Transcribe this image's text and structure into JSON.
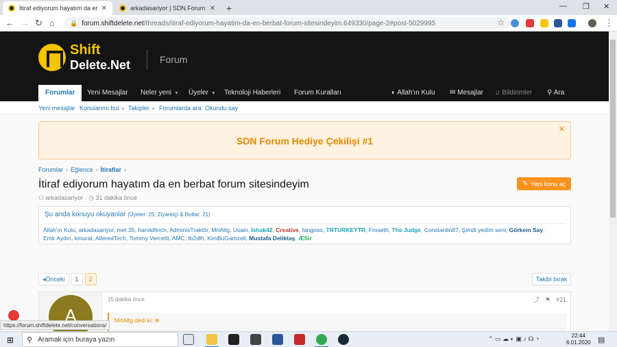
{
  "browser": {
    "tabs": [
      {
        "title": "İtiraf ediyorum hayatım da en be"
      },
      {
        "title": "arkadasariyor | SDN Forum"
      }
    ],
    "new_tab": "+",
    "url_host": "forum.shiftdelete.net",
    "url_path": "/threads/itiraf-ediyorum-hayatim-da-en-berbat-forum-sitesindeyim.649330/page-2#post-5029995"
  },
  "site": {
    "logo_line1": "Shift",
    "logo_line2": "Delete.Net",
    "section": "Forum"
  },
  "nav": {
    "items": [
      "Forumlar",
      "Yeni Mesajlar",
      "Neler yeni",
      "Üyeler",
      "Teknoloji Haberleri",
      "Forum Kuralları"
    ],
    "user": "Allah'ın Kulu",
    "messages": "Mesajlar",
    "alerts": "Bildirimler",
    "search": "Ara"
  },
  "subnav": [
    "Yeni mesajlar",
    "Konulanmı bul",
    "Takipler",
    "Forumlarda ara",
    "Okundu say"
  ],
  "notice": "SDN Forum Hediye Çekilişi #1",
  "breadcrumb": [
    "Forumlar",
    "Eğlence",
    "İtiraflar"
  ],
  "thread": {
    "title": "İtiraf ediyorum hayatım da en berbat forum sitesindeyim",
    "author": "arkadasariyor",
    "time": "31 dakika önce",
    "new_thread_label": "Yeni konu aç"
  },
  "viewers": {
    "heading": "Şu anda konuyu okuyanlar",
    "subheading": "(Üyeler: 25, Ziyaretçi & Botlar: 21)",
    "names": [
      {
        "name": "Allah'ın Kulu",
        "color": "#2577b1",
        "bold": false
      },
      {
        "name": "arkadasariyor",
        "color": "#2577b1",
        "bold": false
      },
      {
        "name": "met 35",
        "color": "#2577b1",
        "bold": false
      },
      {
        "name": "haroldfinch",
        "color": "#2577b1",
        "bold": false
      },
      {
        "name": "AdminisTraktör",
        "color": "#2577b1",
        "bold": false
      },
      {
        "name": "MrtAltg",
        "color": "#2577b1",
        "bold": false
      },
      {
        "name": "Usain",
        "color": "#2577b1",
        "bold": false
      },
      {
        "name": "İshak42",
        "color": "#17a2b8",
        "bold": true
      },
      {
        "name": "Creative",
        "color": "#c0392b",
        "bold": true
      },
      {
        "name": "fangoso",
        "color": "#2577b1",
        "bold": false
      },
      {
        "name": "TRTURKEYTR",
        "color": "#17a2b8",
        "bold": true
      },
      {
        "name": "Froseth",
        "color": "#2577b1",
        "bold": false
      },
      {
        "name": "The Judge",
        "color": "#17a2b8",
        "bold": true
      },
      {
        "name": "Constantin87",
        "color": "#2577b1",
        "bold": false
      },
      {
        "name": "Şimdi yedim seni",
        "color": "#2577b1",
        "bold": false
      },
      {
        "name": "Görkem Say",
        "color": "#1c5a8c",
        "bold": true
      },
      {
        "name": "Emir Aydın",
        "color": "#2577b1",
        "bold": false
      },
      {
        "name": "kmurat",
        "color": "#2577b1",
        "bold": false
      },
      {
        "name": "AlteredTech",
        "color": "#2577b1",
        "bold": false
      },
      {
        "name": "Tommy Vercetti",
        "color": "#2577b1",
        "bold": false
      },
      {
        "name": "AMC",
        "color": "#2577b1",
        "bold": false
      },
      {
        "name": "tb2dlh",
        "color": "#2577b1",
        "bold": false
      },
      {
        "name": "KimBuGamzeli",
        "color": "#2577b1",
        "bold": false
      },
      {
        "name": "Mustafa Deliktaş",
        "color": "#1c5a8c",
        "bold": true
      },
      {
        "name": "ÆSir",
        "color": "#27ae60",
        "bold": true
      }
    ]
  },
  "pager": {
    "prev": "◂Önceki",
    "pages": [
      "1",
      "2"
    ],
    "current": "2",
    "unwatch": "Takibi bırak"
  },
  "post": {
    "avatar_letter": "A",
    "time": "15 dakika önce",
    "number": "#21",
    "quote_author": "MrtAltg dedi ki:"
  },
  "status_url": "https://forum.shiftdelete.net/conversations/",
  "taskbar": {
    "search_placeholder": "Aramak için buraya yazın",
    "time": "22:44",
    "date": "6.01.2020"
  },
  "colors": {
    "header_bg": "#141414",
    "brand_yellow": "#f5c400",
    "link_blue": "#2577b1",
    "accent_orange": "#f7931e"
  }
}
